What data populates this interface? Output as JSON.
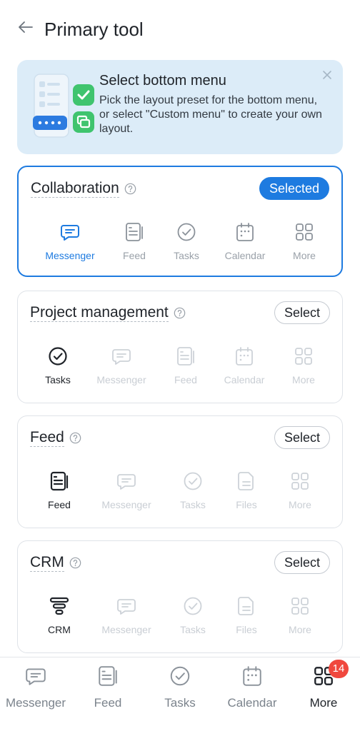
{
  "header": {
    "title": "Primary tool",
    "back_icon": "arrow-left-icon"
  },
  "banner": {
    "title": "Select bottom menu",
    "text": "Pick the layout preset for the bottom menu, or select \"Custom menu\" to create your own layout.",
    "close_icon": "close-icon"
  },
  "presets": [
    {
      "title": "Collaboration",
      "button": "Selected",
      "selected": true,
      "items": [
        {
          "label": "Messenger",
          "icon": "messenger-icon"
        },
        {
          "label": "Feed",
          "icon": "feed-icon"
        },
        {
          "label": "Tasks",
          "icon": "tasks-icon"
        },
        {
          "label": "Calendar",
          "icon": "calendar-icon"
        },
        {
          "label": "More",
          "icon": "grid-icon"
        }
      ]
    },
    {
      "title": "Project management",
      "button": "Select",
      "selected": false,
      "items": [
        {
          "label": "Tasks",
          "icon": "tasks-icon"
        },
        {
          "label": "Messenger",
          "icon": "messenger-icon"
        },
        {
          "label": "Feed",
          "icon": "feed-icon"
        },
        {
          "label": "Calendar",
          "icon": "calendar-icon"
        },
        {
          "label": "More",
          "icon": "grid-icon"
        }
      ]
    },
    {
      "title": "Feed",
      "button": "Select",
      "selected": false,
      "items": [
        {
          "label": "Feed",
          "icon": "feed-icon"
        },
        {
          "label": "Messenger",
          "icon": "messenger-icon"
        },
        {
          "label": "Tasks",
          "icon": "tasks-icon"
        },
        {
          "label": "Files",
          "icon": "file-icon"
        },
        {
          "label": "More",
          "icon": "grid-icon"
        }
      ]
    },
    {
      "title": "CRM",
      "button": "Select",
      "selected": false,
      "items": [
        {
          "label": "CRM",
          "icon": "crm-funnel-icon"
        },
        {
          "label": "Messenger",
          "icon": "messenger-icon"
        },
        {
          "label": "Tasks",
          "icon": "tasks-icon"
        },
        {
          "label": "Files",
          "icon": "file-icon"
        },
        {
          "label": "More",
          "icon": "grid-icon"
        }
      ]
    }
  ],
  "bottom_nav": {
    "tabs": [
      {
        "label": "Messenger",
        "icon": "messenger-icon"
      },
      {
        "label": "Feed",
        "icon": "feed-icon"
      },
      {
        "label": "Tasks",
        "icon": "tasks-icon"
      },
      {
        "label": "Calendar",
        "icon": "calendar-icon"
      },
      {
        "label": "More",
        "icon": "grid-icon",
        "active": true,
        "badge": "14"
      }
    ]
  },
  "colors": {
    "accent": "#1e7be0",
    "banner_bg": "#dcecf8",
    "badge_red": "#f0483e",
    "check_green": "#3fc46e"
  }
}
